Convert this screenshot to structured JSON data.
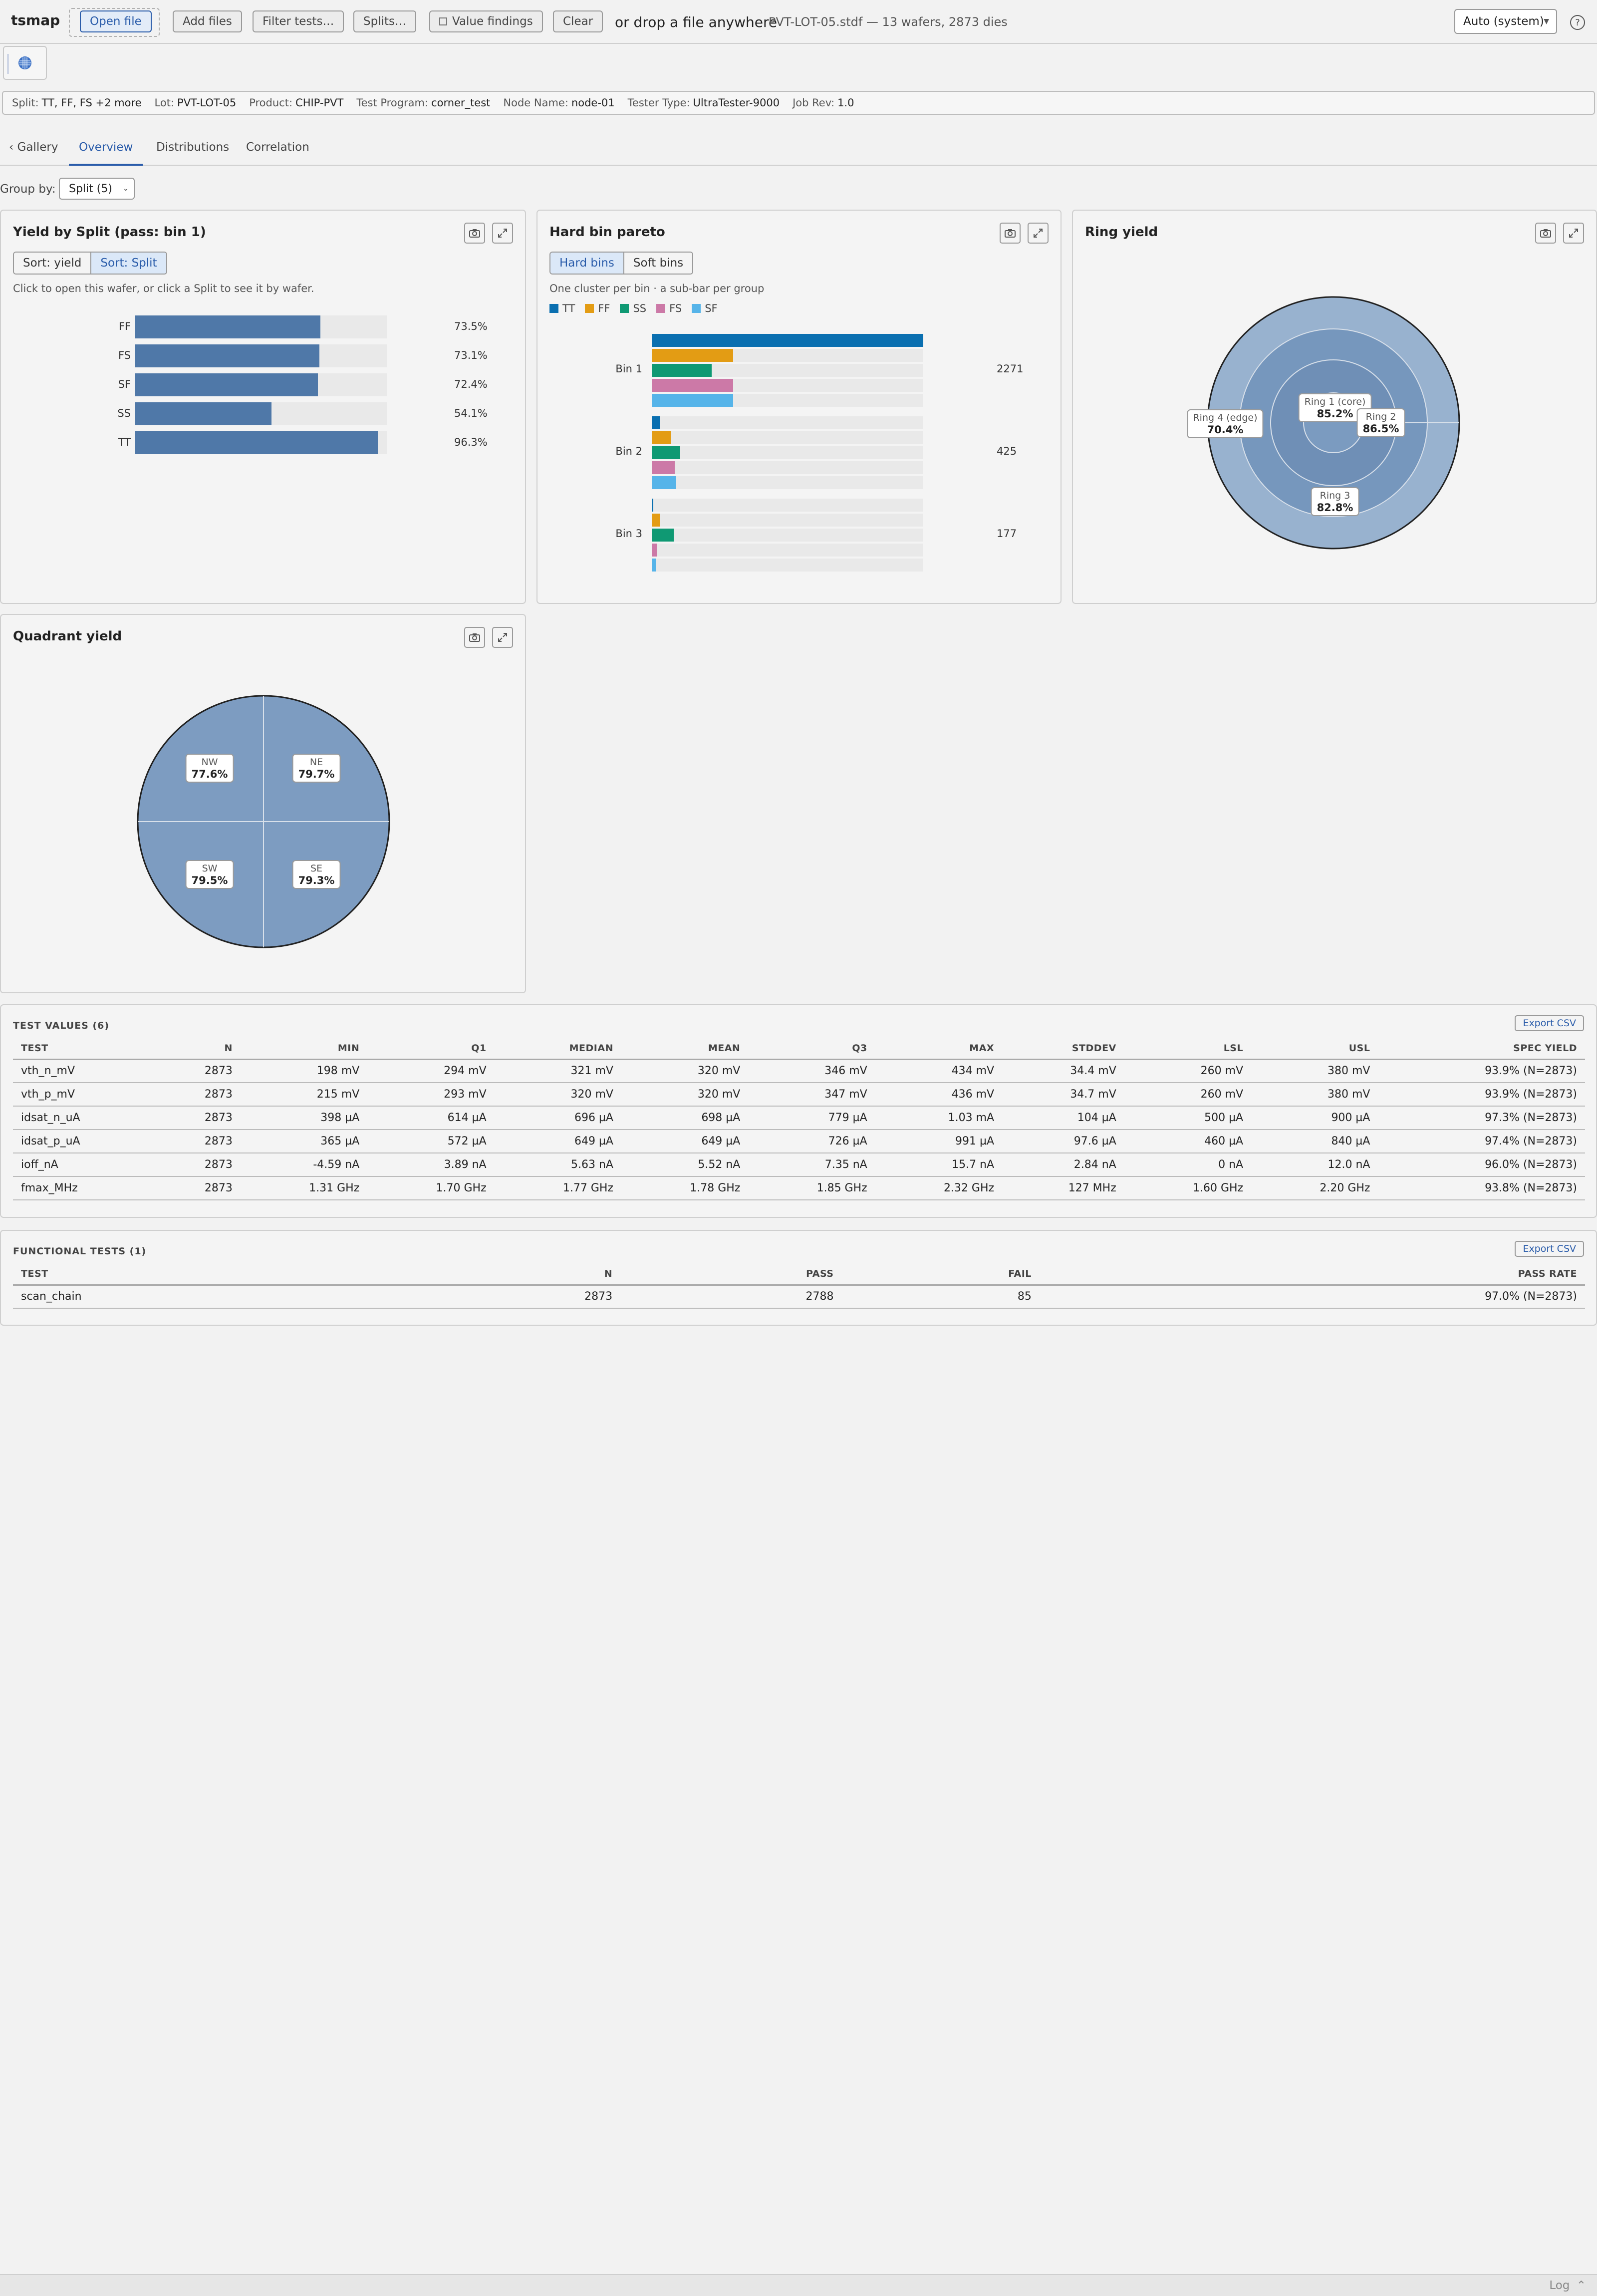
{
  "app": {
    "name": "tsmap",
    "open_file": "Open file",
    "add_files": "Add files",
    "filter_tests": "Filter tests…",
    "splits": "Splits…",
    "value_findings": "Value findings",
    "clear": "Clear",
    "drop_hint": "or drop a file anywhere",
    "file_info": "PVT-LOT-05.stdf — 13 wafers, 2873 dies",
    "theme": "Auto (system)",
    "help": "?"
  },
  "meta": [
    {
      "label": "Split:",
      "value": "TT, FF, FS +2 more"
    },
    {
      "label": "Lot:",
      "value": "PVT-LOT-05"
    },
    {
      "label": "Product:",
      "value": "CHIP-PVT"
    },
    {
      "label": "Test Program:",
      "value": "corner_test"
    },
    {
      "label": "Node Name:",
      "value": "node-01"
    },
    {
      "label": "Tester Type:",
      "value": "UltraTester-9000"
    },
    {
      "label": "Job Rev:",
      "value": "1.0"
    }
  ],
  "tabs": {
    "gallery": "‹ Gallery",
    "overview": "Overview",
    "distributions": "Distributions",
    "correlation": "Correlation",
    "active": "overview"
  },
  "group_by": {
    "label": "Group by:",
    "value": "Split (5)"
  },
  "yield_by_split": {
    "title": "Yield by Split (pass: bin 1)",
    "sort_yield": "Sort: yield",
    "sort_split": "Sort: Split",
    "hint": "Click to open this wafer, or click a Split to see it by wafer.",
    "bar_color": "#4f78a8",
    "rows": [
      {
        "name": "FF",
        "value": 73.5,
        "label": "73.5%"
      },
      {
        "name": "FS",
        "value": 73.1,
        "label": "73.1%"
      },
      {
        "name": "SF",
        "value": 72.4,
        "label": "72.4%"
      },
      {
        "name": "SS",
        "value": 54.1,
        "label": "54.1%"
      },
      {
        "name": "TT",
        "value": 96.3,
        "label": "96.3%"
      }
    ]
  },
  "pareto": {
    "title": "Hard bin pareto",
    "hard_bins": "Hard bins",
    "soft_bins": "Soft bins",
    "subtitle": "One cluster per bin · a sub-bar per group",
    "legend": [
      {
        "name": "TT",
        "color": "#0a6fb0"
      },
      {
        "name": "FF",
        "color": "#e39c14"
      },
      {
        "name": "SS",
        "color": "#0f9973"
      },
      {
        "name": "FS",
        "color": "#cc79a7"
      },
      {
        "name": "SF",
        "color": "#56b4e9"
      }
    ],
    "bins": [
      {
        "name": "Bin 1",
        "total": "2271",
        "fractions": [
          1.0,
          0.3,
          0.22,
          0.3,
          0.3
        ]
      },
      {
        "name": "Bin 2",
        "total": "425",
        "fractions": [
          0.03,
          0.07,
          0.105,
          0.085,
          0.09
        ]
      },
      {
        "name": "Bin 3",
        "total": "177",
        "fractions": [
          0.005,
          0.03,
          0.08,
          0.018,
          0.015
        ]
      }
    ]
  },
  "ring_yield": {
    "title": "Ring yield",
    "rings": [
      {
        "name": "Ring 1 (core)",
        "value": "85.2%"
      },
      {
        "name": "Ring 2",
        "value": "86.5%"
      },
      {
        "name": "Ring 3",
        "value": "82.8%"
      },
      {
        "name": "Ring 4 (edge)",
        "value": "70.4%"
      }
    ],
    "colors": [
      "#7b9bc0",
      "#6f8fb6",
      "#7697bd",
      "#98b2cf"
    ]
  },
  "quadrant_yield": {
    "title": "Quadrant yield",
    "color": "#7d9cc1",
    "quadrants": [
      {
        "name": "NW",
        "value": "77.6%"
      },
      {
        "name": "NE",
        "value": "79.7%"
      },
      {
        "name": "SW",
        "value": "79.5%"
      },
      {
        "name": "SE",
        "value": "79.3%"
      }
    ]
  },
  "test_values": {
    "title": "TEST VALUES (6)",
    "export": "Export CSV",
    "headers": [
      "TEST",
      "N",
      "MIN",
      "Q1",
      "MEDIAN",
      "MEAN",
      "Q3",
      "MAX",
      "STDDEV",
      "LSL",
      "USL",
      "SPEC YIELD"
    ],
    "rows": [
      [
        "vth_n_mV",
        "2873",
        "198 mV",
        "294 mV",
        "321 mV",
        "320 mV",
        "346 mV",
        "434 mV",
        "34.4 mV",
        "260 mV",
        "380 mV",
        "93.9% (N=2873)"
      ],
      [
        "vth_p_mV",
        "2873",
        "215 mV",
        "293 mV",
        "320 mV",
        "320 mV",
        "347 mV",
        "436 mV",
        "34.7 mV",
        "260 mV",
        "380 mV",
        "93.9% (N=2873)"
      ],
      [
        "idsat_n_uA",
        "2873",
        "398 µA",
        "614 µA",
        "696 µA",
        "698 µA",
        "779 µA",
        "1.03 mA",
        "104 µA",
        "500 µA",
        "900 µA",
        "97.3% (N=2873)"
      ],
      [
        "idsat_p_uA",
        "2873",
        "365 µA",
        "572 µA",
        "649 µA",
        "649 µA",
        "726 µA",
        "991 µA",
        "97.6 µA",
        "460 µA",
        "840 µA",
        "97.4% (N=2873)"
      ],
      [
        "ioff_nA",
        "2873",
        "-4.59 nA",
        "3.89 nA",
        "5.63 nA",
        "5.52 nA",
        "7.35 nA",
        "15.7 nA",
        "2.84 nA",
        "0 nA",
        "12.0 nA",
        "96.0% (N=2873)"
      ],
      [
        "fmax_MHz",
        "2873",
        "1.31 GHz",
        "1.70 GHz",
        "1.77 GHz",
        "1.78 GHz",
        "1.85 GHz",
        "2.32 GHz",
        "127 MHz",
        "1.60 GHz",
        "2.20 GHz",
        "93.8% (N=2873)"
      ]
    ]
  },
  "functional": {
    "title": "FUNCTIONAL TESTS (1)",
    "export": "Export CSV",
    "headers": [
      "TEST",
      "N",
      "PASS",
      "FAIL",
      "PASS RATE"
    ],
    "rows": [
      [
        "scan_chain",
        "2873",
        "2788",
        "85",
        "97.0% (N=2873)"
      ]
    ]
  },
  "log": {
    "label": "Log"
  }
}
